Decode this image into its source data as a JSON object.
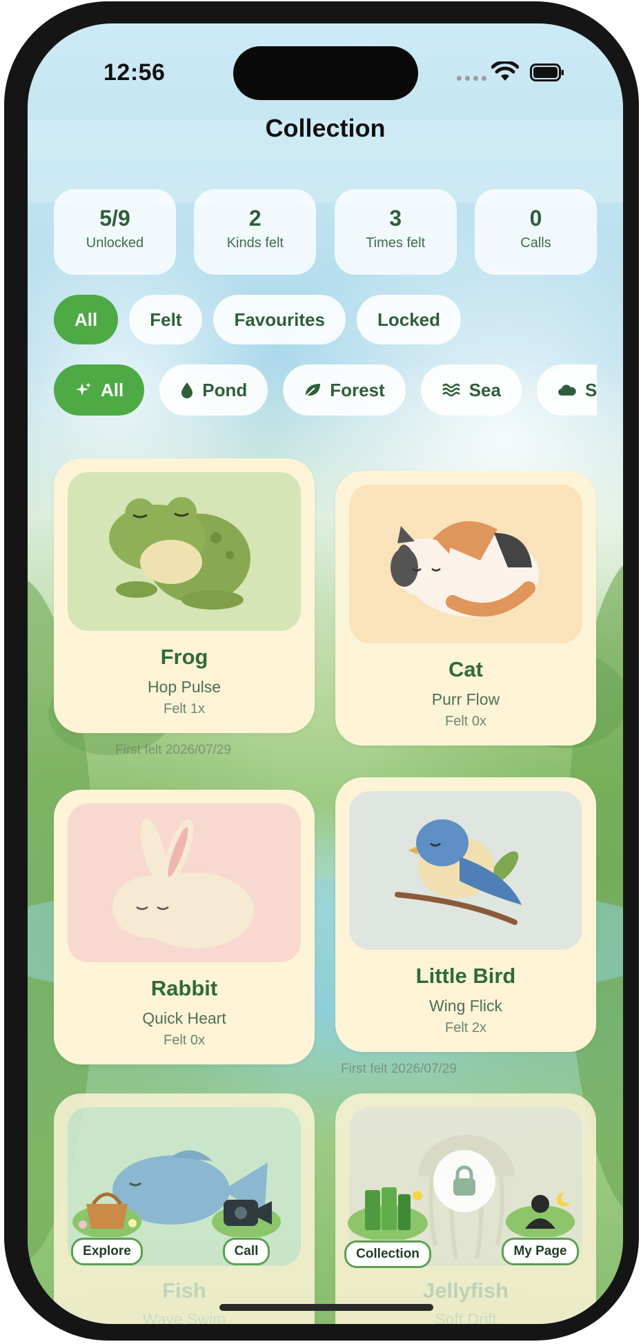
{
  "status": {
    "time": "12:56"
  },
  "header": {
    "title": "Collection"
  },
  "stats": [
    {
      "value": "5/9",
      "label": "Unlocked"
    },
    {
      "value": "2",
      "label": "Kinds felt"
    },
    {
      "value": "3",
      "label": "Times felt"
    },
    {
      "value": "0",
      "label": "Calls"
    }
  ],
  "filters": [
    "All",
    "Felt",
    "Favourites",
    "Locked"
  ],
  "categories": [
    {
      "label": "All",
      "icon": "sparkle-icon"
    },
    {
      "label": "Pond",
      "icon": "water-drop-icon"
    },
    {
      "label": "Forest",
      "icon": "leaf-icon"
    },
    {
      "label": "Sea",
      "icon": "waves-icon"
    },
    {
      "label": "S",
      "icon": "cloud-icon"
    }
  ],
  "cards": [
    {
      "name": "Frog",
      "sub": "Hop Pulse",
      "felt": "Felt 1x",
      "first_felt": "First felt 2026/07/29"
    },
    {
      "name": "Cat",
      "sub": "Purr Flow",
      "felt": "Felt 0x"
    },
    {
      "name": "Rabbit",
      "sub": "Quick Heart",
      "felt": "Felt 0x"
    },
    {
      "name": "Little Bird",
      "sub": "Wing Flick",
      "felt": "Felt 2x",
      "first_felt": "First felt 2026/07/29"
    },
    {
      "name": "Fish",
      "sub": "Wave Swim"
    },
    {
      "name": "Jellyfish",
      "sub": "Soft Drift"
    }
  ],
  "tabs": [
    {
      "label": "Explore",
      "icon": "basket-icon"
    },
    {
      "label": "Call",
      "icon": "video-camera-icon"
    },
    {
      "label": "Collection",
      "icon": "books-icon"
    },
    {
      "label": "My Page",
      "icon": "person-moon-icon"
    }
  ],
  "colors": {
    "accent": "#4daa45",
    "card": "#fdf4d7",
    "text_green": "#2f6a3a"
  }
}
